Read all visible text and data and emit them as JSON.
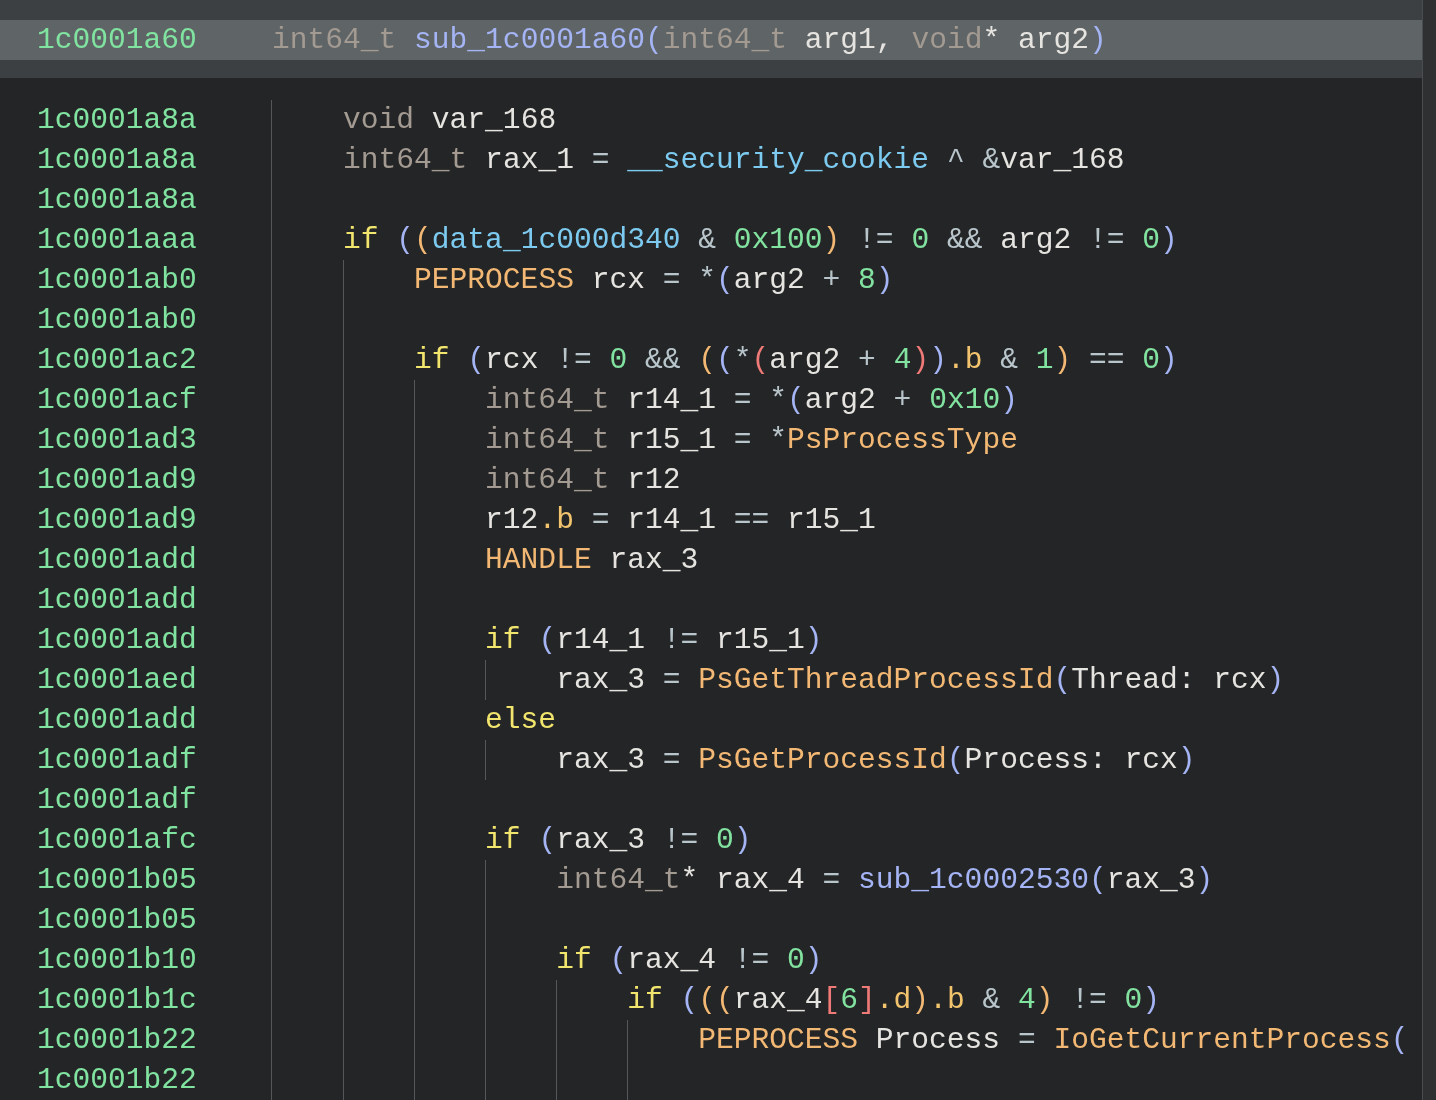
{
  "header": {
    "address": "1c0001a60",
    "tokens": [
      {
        "text": "int64_t ",
        "kind": "type"
      },
      {
        "text": "sub_1c0001a60",
        "kind": "sub"
      },
      {
        "text": "(",
        "kind": "p1"
      },
      {
        "text": "int64_t",
        "kind": "type"
      },
      {
        "text": " arg1, ",
        "kind": "var"
      },
      {
        "text": "void",
        "kind": "type"
      },
      {
        "text": "* arg2",
        "kind": "var"
      },
      {
        "text": ")",
        "kind": "p1"
      }
    ]
  },
  "lines": [
    {
      "address": "1c0001a8a",
      "tokens": [
        {
          "text": "void",
          "kind": "type"
        },
        {
          "text": " var_168",
          "kind": "var"
        }
      ]
    },
    {
      "address": "1c0001a8a",
      "tokens": [
        {
          "text": "int64_t",
          "kind": "type"
        },
        {
          "text": " rax_1 ",
          "kind": "var"
        },
        {
          "text": "= ",
          "kind": "op"
        },
        {
          "text": "__security_cookie",
          "kind": "global"
        },
        {
          "text": " ^ &",
          "kind": "op"
        },
        {
          "text": "var_168",
          "kind": "var"
        }
      ]
    },
    {
      "address": "1c0001a8a"
    },
    {
      "address": "1c0001aaa",
      "tokens": [
        {
          "text": "if ",
          "kind": "kw"
        },
        {
          "text": "(",
          "kind": "p1"
        },
        {
          "text": "(",
          "kind": "p2"
        },
        {
          "text": "data_1c000d340",
          "kind": "global"
        },
        {
          "text": " & ",
          "kind": "op"
        },
        {
          "text": "0x100",
          "kind": "num"
        },
        {
          "text": ")",
          "kind": "p2"
        },
        {
          "text": " != ",
          "kind": "op"
        },
        {
          "text": "0",
          "kind": "num"
        },
        {
          "text": " && ",
          "kind": "op"
        },
        {
          "text": "arg2",
          "kind": "var"
        },
        {
          "text": " != ",
          "kind": "op"
        },
        {
          "text": "0",
          "kind": "num"
        },
        {
          "text": ")",
          "kind": "p1"
        }
      ],
      "children": [
        {
          "address": "1c0001ab0",
          "tokens": [
            {
              "text": "PEPROCESS",
              "kind": "ptype"
            },
            {
              "text": " rcx ",
              "kind": "var"
            },
            {
              "text": "= *",
              "kind": "op"
            },
            {
              "text": "(",
              "kind": "p1"
            },
            {
              "text": "arg2",
              "kind": "var"
            },
            {
              "text": " + ",
              "kind": "op"
            },
            {
              "text": "8",
              "kind": "num"
            },
            {
              "text": ")",
              "kind": "p1"
            }
          ]
        },
        {
          "address": "1c0001ab0"
        },
        {
          "address": "1c0001ac2",
          "tokens": [
            {
              "text": "if ",
              "kind": "kw"
            },
            {
              "text": "(",
              "kind": "p1"
            },
            {
              "text": "rcx",
              "kind": "var"
            },
            {
              "text": " != ",
              "kind": "op"
            },
            {
              "text": "0",
              "kind": "num"
            },
            {
              "text": " && ",
              "kind": "op"
            },
            {
              "text": "(",
              "kind": "p2"
            },
            {
              "text": "(",
              "kind": "p1"
            },
            {
              "text": "*",
              "kind": "op"
            },
            {
              "text": "(",
              "kind": "p3"
            },
            {
              "text": "arg2",
              "kind": "var"
            },
            {
              "text": " + ",
              "kind": "op"
            },
            {
              "text": "4",
              "kind": "num"
            },
            {
              "text": ")",
              "kind": "p3"
            },
            {
              "text": ")",
              "kind": "p1"
            },
            {
              "text": ".b",
              "kind": "field"
            },
            {
              "text": " & ",
              "kind": "op"
            },
            {
              "text": "1",
              "kind": "num"
            },
            {
              "text": ")",
              "kind": "p2"
            },
            {
              "text": " == ",
              "kind": "op"
            },
            {
              "text": "0",
              "kind": "num"
            },
            {
              "text": ")",
              "kind": "p1"
            }
          ],
          "children": [
            {
              "address": "1c0001acf",
              "tokens": [
                {
                  "text": "int64_t",
                  "kind": "type"
                },
                {
                  "text": " r14_1 ",
                  "kind": "var"
                },
                {
                  "text": "= *",
                  "kind": "op"
                },
                {
                  "text": "(",
                  "kind": "p1"
                },
                {
                  "text": "arg2",
                  "kind": "var"
                },
                {
                  "text": " + ",
                  "kind": "op"
                },
                {
                  "text": "0x10",
                  "kind": "num"
                },
                {
                  "text": ")",
                  "kind": "p1"
                }
              ]
            },
            {
              "address": "1c0001ad3",
              "tokens": [
                {
                  "text": "int64_t",
                  "kind": "type"
                },
                {
                  "text": " r15_1 ",
                  "kind": "var"
                },
                {
                  "text": "= *",
                  "kind": "op"
                },
                {
                  "text": "PsProcessType",
                  "kind": "call"
                }
              ]
            },
            {
              "address": "1c0001ad9",
              "tokens": [
                {
                  "text": "int64_t",
                  "kind": "type"
                },
                {
                  "text": " r12",
                  "kind": "var"
                }
              ]
            },
            {
              "address": "1c0001ad9",
              "tokens": [
                {
                  "text": "r12",
                  "kind": "var"
                },
                {
                  "text": ".b",
                  "kind": "field"
                },
                {
                  "text": " = ",
                  "kind": "op"
                },
                {
                  "text": "r14_1",
                  "kind": "var"
                },
                {
                  "text": " == ",
                  "kind": "op"
                },
                {
                  "text": "r15_1",
                  "kind": "var"
                }
              ]
            },
            {
              "address": "1c0001add",
              "tokens": [
                {
                  "text": "HANDLE",
                  "kind": "ptype"
                },
                {
                  "text": " rax_3",
                  "kind": "var"
                }
              ]
            },
            {
              "address": "1c0001add"
            },
            {
              "address": "1c0001add",
              "tokens": [
                {
                  "text": "if ",
                  "kind": "kw"
                },
                {
                  "text": "(",
                  "kind": "p1"
                },
                {
                  "text": "r14_1",
                  "kind": "var"
                },
                {
                  "text": " != ",
                  "kind": "op"
                },
                {
                  "text": "r15_1",
                  "kind": "var"
                },
                {
                  "text": ")",
                  "kind": "p1"
                }
              ],
              "children": [
                {
                  "address": "1c0001aed",
                  "tokens": [
                    {
                      "text": "rax_3",
                      "kind": "var"
                    },
                    {
                      "text": " = ",
                      "kind": "op"
                    },
                    {
                      "text": "PsGetThreadProcessId",
                      "kind": "call"
                    },
                    {
                      "text": "(",
                      "kind": "p1"
                    },
                    {
                      "text": "Thread: rcx",
                      "kind": "var"
                    },
                    {
                      "text": ")",
                      "kind": "p1"
                    }
                  ]
                }
              ]
            },
            {
              "address": "1c0001add",
              "tokens": [
                {
                  "text": "else",
                  "kind": "kw"
                }
              ],
              "children": [
                {
                  "address": "1c0001adf",
                  "tokens": [
                    {
                      "text": "rax_3",
                      "kind": "var"
                    },
                    {
                      "text": " = ",
                      "kind": "op"
                    },
                    {
                      "text": "PsGetProcessId",
                      "kind": "call"
                    },
                    {
                      "text": "(",
                      "kind": "p1"
                    },
                    {
                      "text": "Process: rcx",
                      "kind": "var"
                    },
                    {
                      "text": ")",
                      "kind": "p1"
                    }
                  ]
                }
              ]
            },
            {
              "address": "1c0001adf"
            },
            {
              "address": "1c0001afc",
              "tokens": [
                {
                  "text": "if ",
                  "kind": "kw"
                },
                {
                  "text": "(",
                  "kind": "p1"
                },
                {
                  "text": "rax_3",
                  "kind": "var"
                },
                {
                  "text": " != ",
                  "kind": "op"
                },
                {
                  "text": "0",
                  "kind": "num"
                },
                {
                  "text": ")",
                  "kind": "p1"
                }
              ],
              "children": [
                {
                  "address": "1c0001b05",
                  "tokens": [
                    {
                      "text": "int64_t",
                      "kind": "type"
                    },
                    {
                      "text": "* rax_4 ",
                      "kind": "var"
                    },
                    {
                      "text": "= ",
                      "kind": "op"
                    },
                    {
                      "text": "sub_1c0002530",
                      "kind": "sub"
                    },
                    {
                      "text": "(",
                      "kind": "p1"
                    },
                    {
                      "text": "rax_3",
                      "kind": "var"
                    },
                    {
                      "text": ")",
                      "kind": "p1"
                    }
                  ]
                },
                {
                  "address": "1c0001b05"
                },
                {
                  "address": "1c0001b10",
                  "tokens": [
                    {
                      "text": "if ",
                      "kind": "kw"
                    },
                    {
                      "text": "(",
                      "kind": "p1"
                    },
                    {
                      "text": "rax_4",
                      "kind": "var"
                    },
                    {
                      "text": " != ",
                      "kind": "op"
                    },
                    {
                      "text": "0",
                      "kind": "num"
                    },
                    {
                      "text": ")",
                      "kind": "p1"
                    }
                  ],
                  "children": [
                    {
                      "address": "1c0001b1c",
                      "tokens": [
                        {
                          "text": "if ",
                          "kind": "kw"
                        },
                        {
                          "text": "(",
                          "kind": "p1"
                        },
                        {
                          "text": "(",
                          "kind": "p2"
                        },
                        {
                          "text": "(",
                          "kind": "p2"
                        },
                        {
                          "text": "rax_4",
                          "kind": "var"
                        },
                        {
                          "text": "[",
                          "kind": "p3"
                        },
                        {
                          "text": "6",
                          "kind": "num"
                        },
                        {
                          "text": "]",
                          "kind": "p3"
                        },
                        {
                          "text": ".d",
                          "kind": "field"
                        },
                        {
                          "text": ")",
                          "kind": "p2"
                        },
                        {
                          "text": ".b",
                          "kind": "field"
                        },
                        {
                          "text": " & ",
                          "kind": "op"
                        },
                        {
                          "text": "4",
                          "kind": "num"
                        },
                        {
                          "text": ")",
                          "kind": "p2"
                        },
                        {
                          "text": " != ",
                          "kind": "op"
                        },
                        {
                          "text": "0",
                          "kind": "num"
                        },
                        {
                          "text": ")",
                          "kind": "p1"
                        }
                      ],
                      "children": [
                        {
                          "address": "1c0001b22",
                          "tokens": [
                            {
                              "text": "PEPROCESS",
                              "kind": "ptype"
                            },
                            {
                              "text": " Process ",
                              "kind": "var"
                            },
                            {
                              "text": "= ",
                              "kind": "op"
                            },
                            {
                              "text": "IoGetCurrentProcess",
                              "kind": "call"
                            },
                            {
                              "text": "(",
                              "kind": "p1"
                            }
                          ]
                        },
                        {
                          "address": "1c0001b22"
                        }
                      ]
                    }
                  ]
                }
              ]
            }
          ]
        }
      ]
    }
  ]
}
